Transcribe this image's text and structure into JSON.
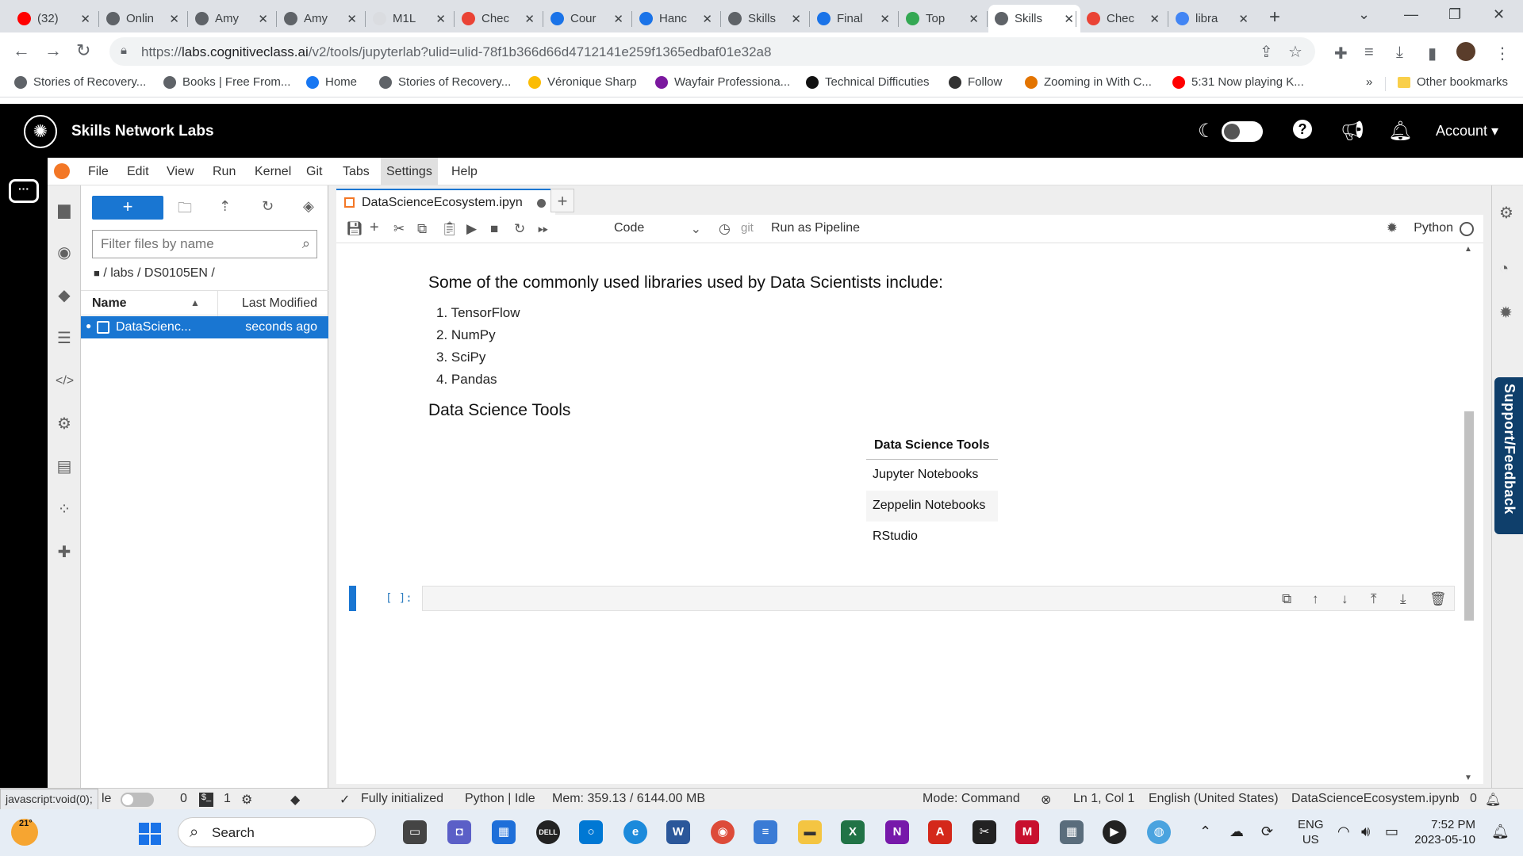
{
  "browser": {
    "tabs": [
      {
        "label": "(32)",
        "favicon_color": "#ff0000",
        "favicon": "youtube-icon"
      },
      {
        "label": "Onlin",
        "favicon_color": "#5f6368",
        "favicon": "tool-icon"
      },
      {
        "label": "Amy",
        "favicon_color": "#5f6368",
        "favicon": "globe-icon"
      },
      {
        "label": "Amy",
        "favicon_color": "#5f6368",
        "favicon": "globe-icon"
      },
      {
        "label": "M1L",
        "favicon_color": "#dadce0",
        "favicon": "blank-icon"
      },
      {
        "label": "Chec",
        "favicon_color": "#ea4335",
        "favicon": "gmail-icon"
      },
      {
        "label": "Cour",
        "favicon_color": "#1a73e8",
        "favicon": "coursera-icon"
      },
      {
        "label": "Hanc",
        "favicon_color": "#1a73e8",
        "favicon": "coursera-icon"
      },
      {
        "label": "Skills",
        "favicon_color": "#5f6368",
        "favicon": "globe-icon"
      },
      {
        "label": "Final",
        "favicon_color": "#1a73e8",
        "favicon": "coursera-icon"
      },
      {
        "label": "Top",
        "favicon_color": "#34a853",
        "favicon": "location-icon"
      },
      {
        "label": "Skills",
        "favicon_color": "#5f6368",
        "favicon": "globe-icon"
      },
      {
        "label": "Chec",
        "favicon_color": "#ea4335",
        "favicon": "gmail-icon"
      },
      {
        "label": "libra",
        "favicon_color": "#4285f4",
        "favicon": "google-icon"
      }
    ],
    "active_tab_index": 11,
    "url_prefix": "https://",
    "url_host": "labs.cognitiveclass.ai",
    "url_path": "/v2/tools/jupyterlab?ulid=ulid-78f1b366d66d4712141e259f1365edbaf01e32a8",
    "bookmarks": [
      {
        "label": "Stories of Recovery...",
        "icon_color": "#5f6368"
      },
      {
        "label": "Books | Free From...",
        "icon_color": "#5f6368"
      },
      {
        "label": "Home",
        "icon_color": "#1877f2"
      },
      {
        "label": "Stories of Recovery...",
        "icon_color": "#5f6368"
      },
      {
        "label": "Véronique Sharp",
        "icon_color": "#fbbc04"
      },
      {
        "label": "Wayfair Professiona...",
        "icon_color": "#7b189f"
      },
      {
        "label": "Technical Difficuties",
        "icon_color": "#111111"
      },
      {
        "label": "Follow",
        "icon_color": "#333333"
      },
      {
        "label": "Zooming in With C...",
        "icon_color": "#e37400"
      },
      {
        "label": "5:31 Now playing K...",
        "icon_color": "#ff0000"
      }
    ],
    "bookmarks_more": "»",
    "other_bookmarks": "Other bookmarks"
  },
  "header": {
    "title": "Skills Network Labs",
    "account": "Account"
  },
  "menubar": [
    "File",
    "Edit",
    "View",
    "Run",
    "Kernel",
    "Git",
    "Tabs",
    "Settings",
    "Help"
  ],
  "filebrowser": {
    "new_label": "+",
    "filter_placeholder": "Filter files by name",
    "path": "/ labs / DS0105EN /",
    "col_name": "Name",
    "col_modified": "Last Modified",
    "file_name": "DataScienc...",
    "file_modified": "seconds ago"
  },
  "notebook": {
    "tab_name": "DataScienceEcosystem.ipyn",
    "cell_type": "Code",
    "git_label": "git",
    "pipeline_label": "Run as Pipeline",
    "kernel": "Python",
    "heading_libraries": "Some of the commonly used libraries used by Data Scientists include:",
    "libraries": [
      "1. TensorFlow",
      "2. NumPy",
      "3. SciPy",
      "4. Pandas"
    ],
    "heading_tools": "Data Science Tools",
    "table_header": "Data Science Tools",
    "tools": [
      "Jupyter Notebooks",
      "Zeppelin Notebooks",
      "RStudio"
    ],
    "prompt": "[ ]:"
  },
  "feedback_label": "Support/Feedback",
  "statusbar": {
    "js_link": "javascript:void(0);",
    "simple_label": "le",
    "terminals": "0",
    "kernels": "1",
    "init": "Fully initialized",
    "kernel_status": "Python | Idle",
    "mem": "Mem: 359.13 / 6144.00 MB",
    "mode": "Mode: Command",
    "position": "Ln 1, Col 1",
    "language": "English (United States)",
    "filename": "DataScienceEcosystem.ipynb",
    "notifications": "0"
  },
  "taskbar": {
    "weather": "21°",
    "search": "Search",
    "lang_top": "ENG",
    "lang_bottom": "US",
    "time": "7:52 PM",
    "date": "2023-05-10"
  }
}
